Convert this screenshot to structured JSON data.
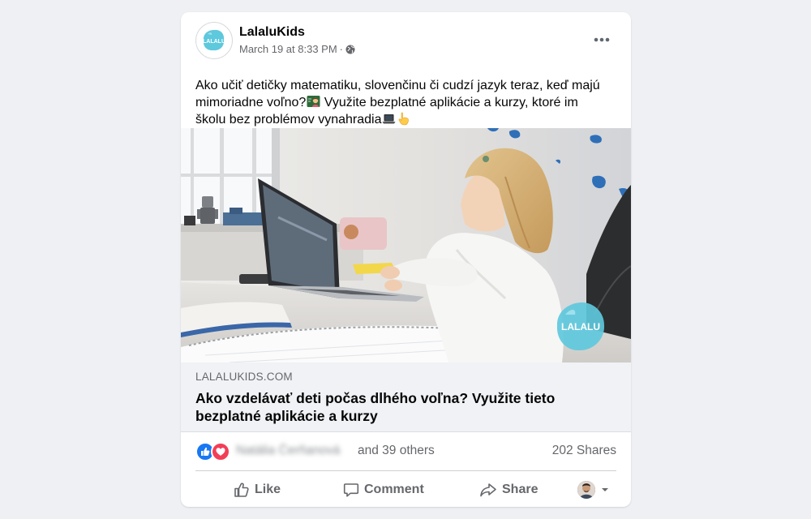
{
  "post": {
    "author": "LalaluKids",
    "logo_text": "LALALU",
    "timestamp": "March 19 at 8:33 PM",
    "separator": "·",
    "privacy_icon": "globe-icon",
    "text_line1": "Ako učiť detičky matematiku, slovenčinu či cudzí jazyk teraz, keď majú",
    "text_line2": "mimoriadne voľno?",
    "text_line2b": " Využite bezplatné aplikácie a kurzy, ktoré im",
    "text_line3": "školu bez problémov vynahradia",
    "more_icon": "more-options-icon"
  },
  "photo": {
    "watermark": "LALALU"
  },
  "link": {
    "domain": "LALALUKIDS.COM",
    "title": "Ako vzdelávať deti počas dlhého voľna? Využite tieto bezplatné aplikácie a kurzy"
  },
  "stats": {
    "reactor_name": "Natália Čerňanová",
    "others": "and 39 others",
    "shares": "202 Shares"
  },
  "actions": {
    "like": "Like",
    "comment": "Comment",
    "share": "Share"
  },
  "colors": {
    "like_blue": "#1877f2",
    "love_red": "#f33e58",
    "brand_teal": "#5ec8dd",
    "text_secondary": "#65676b"
  }
}
